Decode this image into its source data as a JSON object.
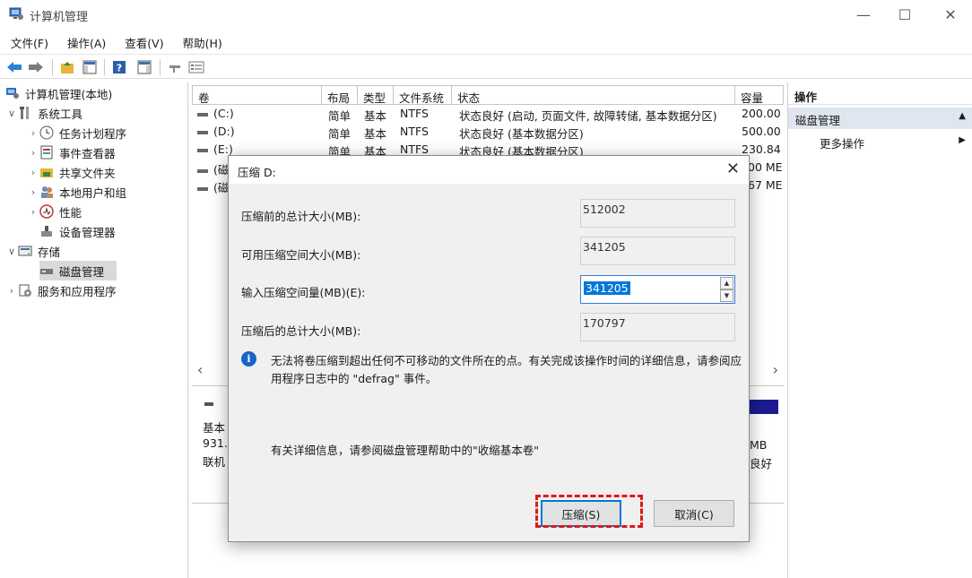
{
  "window": {
    "title": "计算机管理",
    "minimize_glyph": "—",
    "maximize_glyph": "☐",
    "close_glyph": "✕"
  },
  "menu": [
    "文件(F)",
    "操作(A)",
    "查看(V)",
    "帮助(H)"
  ],
  "toolbar": {
    "icons": [
      "back-arrow-icon",
      "forward-arrow-icon",
      "up-folder-icon",
      "show-hide-console-tree-icon",
      "help-icon",
      "show-hide-action-pane-icon",
      "connect-icon",
      "properties-icon"
    ]
  },
  "tree": {
    "root": "计算机管理(本地)",
    "system_tools": "系统工具",
    "task_scheduler": "任务计划程序",
    "event_viewer": "事件查看器",
    "shared_folders": "共享文件夹",
    "local_users": "本地用户和组",
    "performance": "性能",
    "device_manager": "设备管理器",
    "storage": "存储",
    "disk_management": "磁盘管理",
    "services_apps": "服务和应用程序",
    "collapse_glyph": "∨",
    "expand_glyph": "›"
  },
  "volume_list": {
    "headers": [
      "卷",
      "布局",
      "类型",
      "文件系统",
      "状态",
      "容量"
    ],
    "rows": [
      {
        "vol": "(C:)",
        "layout": "简单",
        "type": "基本",
        "fs": "NTFS",
        "status": "状态良好 (启动, 页面文件, 故障转储, 基本数据分区)",
        "capacity": "200.00"
      },
      {
        "vol": "(D:)",
        "layout": "简单",
        "type": "基本",
        "fs": "NTFS",
        "status": "状态良好 (基本数据分区)",
        "capacity": "500.00"
      },
      {
        "vol": "(E:)",
        "layout": "简单",
        "type": "基本",
        "fs": "NTFS",
        "status": "状态良好 (基本数据分区)",
        "capacity": "230.84"
      },
      {
        "vol": "(磁",
        "layout": "",
        "type": "",
        "fs": "",
        "status": "",
        "capacity": "00 ME"
      },
      {
        "vol": "(磁",
        "layout": "",
        "type": "",
        "fs": "",
        "status": "",
        "capacity": "67 ME"
      }
    ],
    "scroll_left": "‹",
    "scroll_right": "›"
  },
  "disk_panel": {
    "line1": "基本",
    "line2": "931.",
    "line3": "联机",
    "right1": "MB",
    "right2": "良好"
  },
  "actions": {
    "header": "操作",
    "section": "磁盘管理",
    "section_arrow": "▲",
    "more": "更多操作",
    "more_arrow": "▶"
  },
  "dialog": {
    "title": "压缩 D:",
    "close_glyph": "✕",
    "total_before_label": "压缩前的总计大小(MB):",
    "total_before_value": "512002",
    "available_label": "可用压缩空间大小(MB):",
    "available_value": "341205",
    "input_label": "输入压缩空间量(MB)(E):",
    "input_value": "341205",
    "total_after_label": "压缩后的总计大小(MB):",
    "total_after_value": "170797",
    "info_glyph": "i",
    "info_text": "无法将卷压缩到超出任何不可移动的文件所在的点。有关完成该操作时间的详细信息，请参阅应用程序日志中的 \"defrag\" 事件。",
    "help_text": "有关详细信息，请参阅磁盘管理帮助中的\"收缩基本卷\"",
    "shrink_button": "压缩(S)",
    "cancel_button": "取消(C)",
    "spin_up": "▲",
    "spin_down": "▼"
  },
  "colors": {
    "selection": "#0078d7",
    "highlight_border": "#e01919",
    "action_section_bg": "#dfe6ef"
  }
}
